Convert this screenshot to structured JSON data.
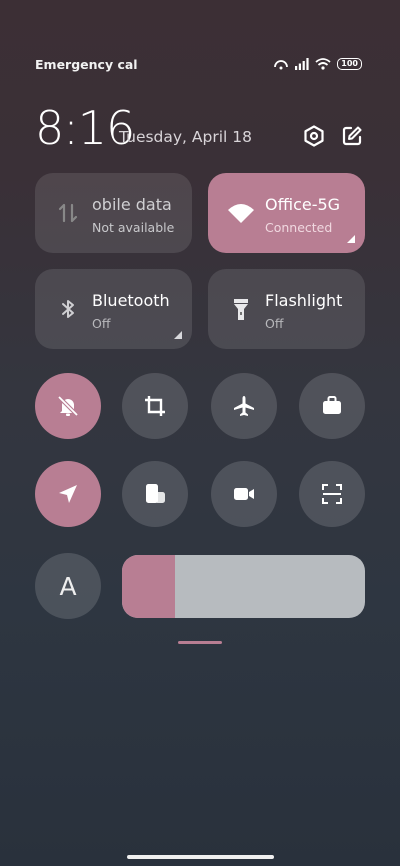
{
  "status_bar": {
    "carrier_text": "Emergency calls o",
    "battery": "100",
    "icons": [
      "hotspot-icon",
      "signal-icon",
      "wifi-icon",
      "battery-icon"
    ]
  },
  "header": {
    "time": "8:16",
    "date": "Tuesday, April 18",
    "icons": [
      "settings-icon",
      "edit-icon"
    ]
  },
  "tiles": {
    "mobile_data": {
      "title": "obile data",
      "subtitle": "Not available",
      "icon": "mobile-data-icon",
      "active": false
    },
    "wifi": {
      "title": "Office-5G",
      "subtitle": "Connected",
      "icon": "wifi-icon",
      "active": true
    },
    "bluetooth": {
      "title": "Bluetooth",
      "subtitle": "Off",
      "icon": "bluetooth-icon",
      "active": false
    },
    "flashlight": {
      "title": "Flashlight",
      "subtitle": "Off",
      "icon": "flashlight-icon",
      "active": false
    }
  },
  "toggles_row1": [
    {
      "icon": "mute-bell-icon",
      "active": true
    },
    {
      "icon": "crop-icon",
      "active": false
    },
    {
      "icon": "airplane-icon",
      "active": false
    },
    {
      "icon": "briefcase-icon",
      "active": false
    }
  ],
  "toggles_row2": [
    {
      "icon": "location-icon",
      "active": true
    },
    {
      "icon": "multi-window-icon",
      "active": false
    },
    {
      "icon": "video-camera-icon",
      "active": false
    },
    {
      "icon": "scan-icon",
      "active": false
    }
  ],
  "auto_brightness": {
    "label": "A"
  },
  "brightness": {
    "level_percent": 22,
    "fill_color": "#b87e93",
    "track_color": "#b7bbbf"
  },
  "colors": {
    "accent": "#b87e93"
  }
}
